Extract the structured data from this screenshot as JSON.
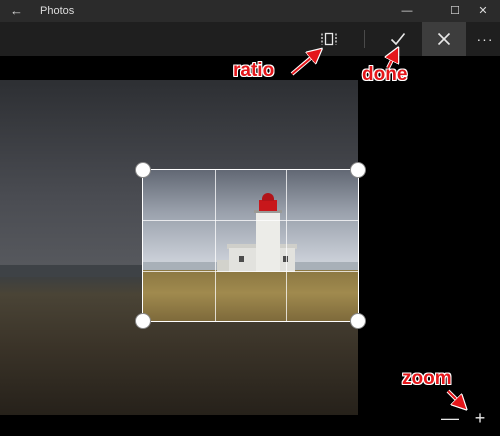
{
  "window": {
    "title": "Photos",
    "back_glyph": "←",
    "minimize_glyph": "—",
    "maximize_glyph": "☐",
    "close_glyph": "✕"
  },
  "toolbar": {
    "ratio_icon": "aspect-ratio-icon",
    "done_icon": "checkmark-icon",
    "cancel_icon": "close-icon",
    "more_label": "···"
  },
  "crop": {
    "grid": "3x3",
    "handle_color": "#ffffff"
  },
  "zoom": {
    "out_glyph": "—",
    "in_glyph": "+"
  },
  "annotations": {
    "ratio": "ratio",
    "done": "done",
    "zoom": "zoom",
    "color": "#e4161a"
  }
}
